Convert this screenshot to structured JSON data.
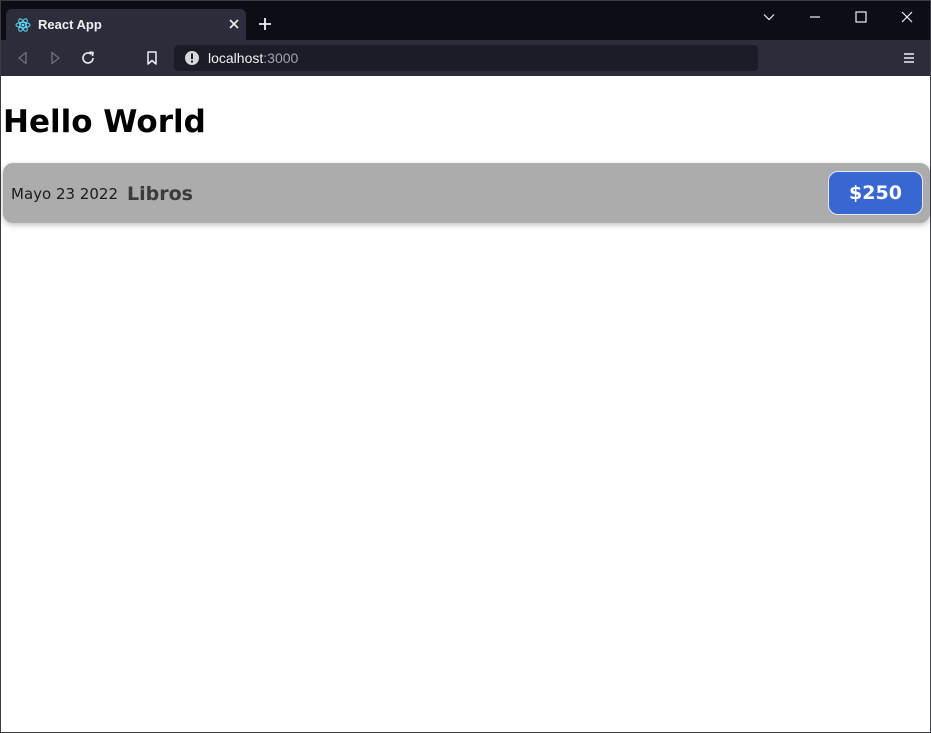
{
  "browser": {
    "tab_title": "React App",
    "url_host": "localhost",
    "url_port": ":3000"
  },
  "page": {
    "heading": "Hello World",
    "expense": {
      "date": "Mayo 23 2022",
      "title": "Libros",
      "amount": "$250"
    }
  },
  "colors": {
    "item_background": "#acacac",
    "price_background": "#3967d1",
    "titlebar": "#0d0d16",
    "toolbar": "#2b2d3b"
  },
  "icons": {
    "favicon": "react-logo-icon",
    "tab_close": "close-icon",
    "new_tab": "plus-icon",
    "tab_list": "chevron-down-icon",
    "minimize": "minimize-icon",
    "maximize": "maximize-icon",
    "close_window": "close-icon",
    "back": "back-arrow-icon",
    "forward": "forward-arrow-icon",
    "reload": "reload-icon",
    "bookmark": "bookmark-icon",
    "site_info": "info-icon",
    "menu": "hamburger-menu-icon"
  }
}
